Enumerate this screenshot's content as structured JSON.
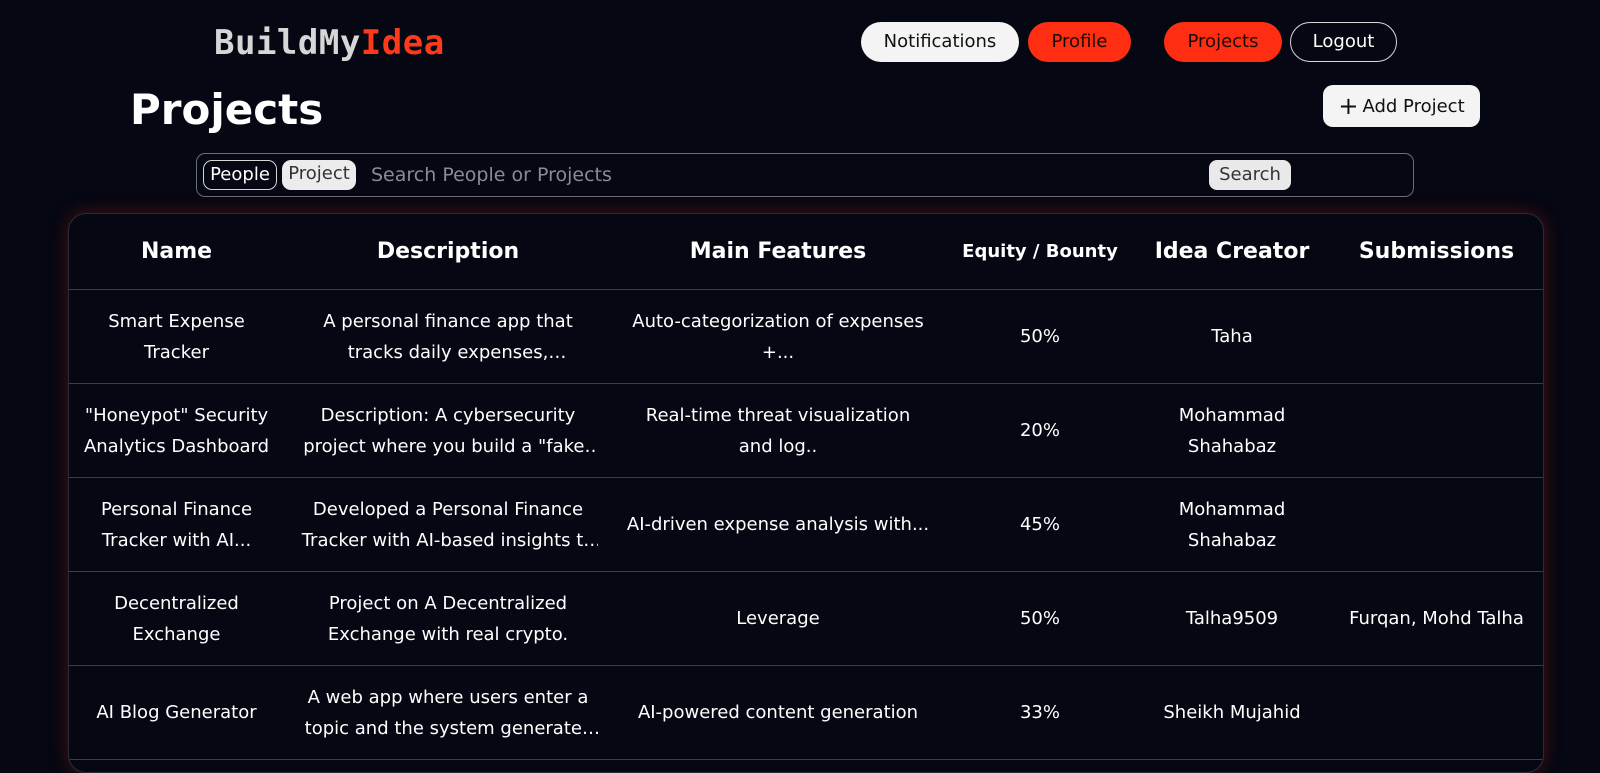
{
  "logo": {
    "part1": "BuildMy",
    "part2": "Idea"
  },
  "nav": {
    "notifications": "Notifications",
    "profile": "Profile",
    "projects": "Projects",
    "logout": "Logout"
  },
  "page_title": "Projects",
  "add_project": {
    "icon": "plus-icon",
    "label": "Add Project"
  },
  "search": {
    "toggle_people": "People",
    "toggle_project": "Project",
    "placeholder": "Search People or Projects",
    "button": "Search"
  },
  "table": {
    "headers": [
      "Name",
      "Description",
      "Main Features",
      "Equity / Bounty",
      "Idea Creator",
      "Submissions"
    ],
    "rows": [
      {
        "name": "Smart Expense Tracker",
        "description": "A personal finance app that tracks daily expenses, categorizes spending...",
        "features": "Auto-categorization of expenses +...",
        "equity": "50%",
        "creator": "Taha",
        "submissions": ""
      },
      {
        "name": "\"Honeypot\" Security Analytics Dashboard",
        "description": "Description: A cybersecurity project where you build a \"fake\" vulnerable system to...",
        "features": "Real-time threat visualization and log..",
        "equity": "20%",
        "creator": "Mohammad Shahabaz",
        "submissions": ""
      },
      {
        "name": "Personal Finance Tracker with AI...",
        "description": "Developed a Personal Finance Tracker with AI-based insights to help users manage an...",
        "features": "AI-driven expense analysis with...",
        "equity": "45%",
        "creator": "Mohammad Shahabaz",
        "submissions": ""
      },
      {
        "name": "Decentralized Exchange",
        "description": "Project on A Decentralized Exchange with real crypto.",
        "features": "Leverage",
        "equity": "50%",
        "creator": "Talha9509",
        "submissions": "Furqan, Mohd Talha"
      },
      {
        "name": "AI Blog Generator",
        "description": "A web app where users enter a topic and the system generates full blog posts using AI....",
        "features": "AI-powered content generation",
        "equity": "33%",
        "creator": "Sheikh Mujahid",
        "submissions": ""
      }
    ]
  },
  "colors": {
    "background": "#050712",
    "accent": "#ff2e12",
    "logo_accent": "#ff3a1a"
  }
}
